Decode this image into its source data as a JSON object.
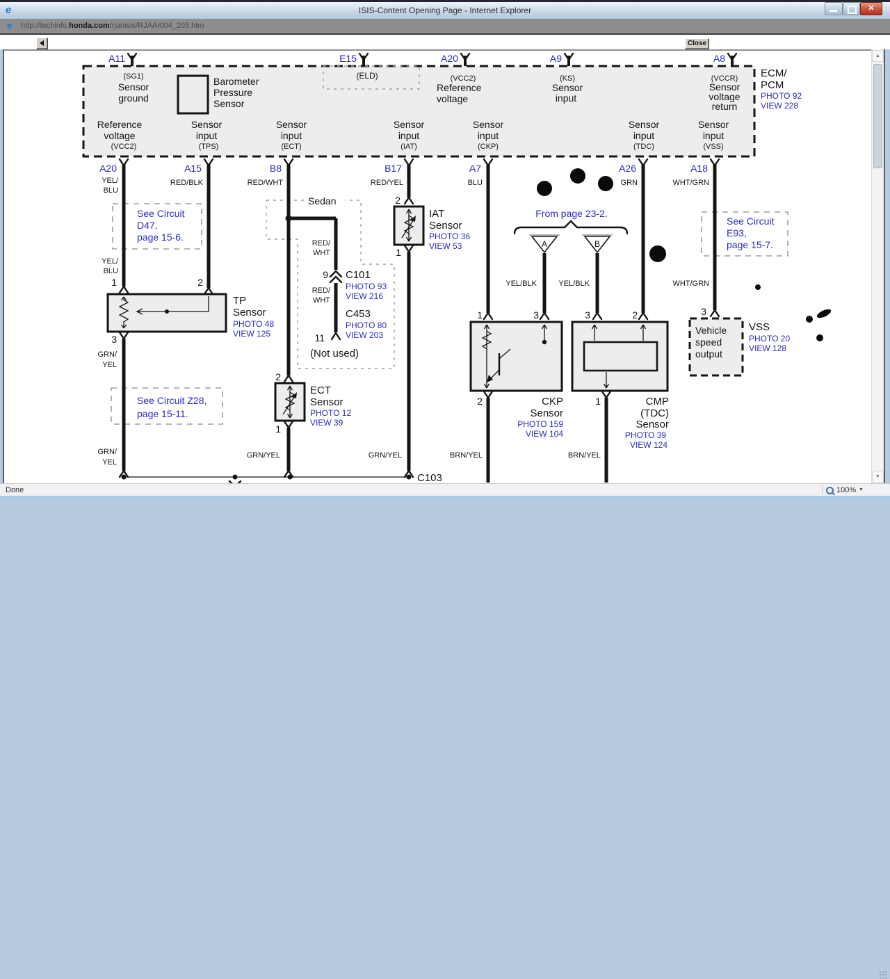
{
  "window": {
    "title": "ISIS-Content Opening Page - Internet Explorer",
    "url_prefix": "http://techinfo.",
    "url_domain": "honda.com",
    "url_path": "/rjanisis/RJAAI004_205.htm",
    "close_button": "Close",
    "status": "Done",
    "zoom": "100%"
  },
  "icons": {
    "ie": "e",
    "close": "✕",
    "scroll_up": "▲",
    "scroll_down": "▼",
    "caret": "▼"
  },
  "ecm": {
    "title1": "ECM/",
    "title2": "PCM",
    "photo": "PHOTO 92",
    "view": "VIEW 228",
    "pin_a11": "A11",
    "pin_e15": "E15",
    "pin_a20": "A20",
    "pin_a9": "A9",
    "pin_a8": "A8",
    "sg1_code": "(SG1)",
    "sg1_1": "Sensor",
    "sg1_2": "ground",
    "baro_1": "Barometer",
    "baro_2": "Pressure",
    "baro_3": "Sensor",
    "eld_code": "(ELD)",
    "vcc2t_code": "(VCC2)",
    "vcc2t_1": "Reference",
    "vcc2t_2": "voltage",
    "ks_code": "(KS)",
    "ks_1": "Sensor",
    "ks_2": "input",
    "vccr_code": "(VCCR)",
    "vccr_1": "Sensor",
    "vccr_2": "voltage",
    "vccr_3": "return",
    "b1_1": "Reference",
    "b1_2": "voltage",
    "b1_code": "(VCC2)",
    "b2_1": "Sensor",
    "b2_2": "input",
    "b2_code": "(TPS)",
    "b3_1": "Sensor",
    "b3_2": "input",
    "b3_code": "(ECT)",
    "b4_1": "Sensor",
    "b4_2": "input",
    "b4_code": "(IAT)",
    "b5_1": "Sensor",
    "b5_2": "input",
    "b5_code": "(CKP)",
    "b6_1": "Sensor",
    "b6_2": "input",
    "b6_code": "(TDC)",
    "b7_1": "Sensor",
    "b7_2": "input",
    "b7_code": "(VSS)"
  },
  "pins": {
    "a20": "A20",
    "a15": "A15",
    "b8": "B8",
    "b17": "B17",
    "a7": "A7",
    "a26": "A26",
    "a18": "A18"
  },
  "wires": {
    "yelblu1a": "YEL/",
    "yelblu1b": "BLU",
    "yelblu2a": "YEL/",
    "yelblu2b": "BLU",
    "redblk": "RED/BLK",
    "redwht": "RED/WHT",
    "redwht2a": "RED/",
    "redwht2b": "WHT",
    "redwht3a": "RED/",
    "redwht3b": "WHT",
    "redyel": "RED/YEL",
    "blu": "BLU",
    "grn": "GRN",
    "whtgrn1": "WHT/GRN",
    "whtgrn2": "WHT/GRN",
    "yelblk1": "YEL/BLK",
    "yelblk2": "YEL/BLK",
    "grnyel1a": "GRN/",
    "grnyel1b": "YEL",
    "grnyel2a": "GRN/",
    "grnyel2b": "YEL",
    "grnyel3": "GRN/YEL",
    "grnyel4": "GRN/YEL",
    "brnyel1": "BRN/YEL",
    "brnyel2": "BRN/YEL"
  },
  "sensors": {
    "tp": {
      "n1": "1",
      "n2": "2",
      "n3": "3",
      "name1": "TP",
      "name2": "Sensor",
      "photo": "PHOTO 48",
      "view": "VIEW 125"
    },
    "ect": {
      "n2": "2",
      "n1": "1",
      "name1": "ECT",
      "name2": "Sensor",
      "photo": "PHOTO 12",
      "view": "VIEW 39"
    },
    "iat": {
      "n2": "2",
      "n1": "1",
      "name1": "IAT",
      "name2": "Sensor",
      "photo": "PHOTO 36",
      "view": "VIEW 53"
    },
    "ckp": {
      "n1": "1",
      "n3": "3",
      "n2": "2",
      "name1": "CKP",
      "name2": "Sensor",
      "photo": "PHOTO 159",
      "view": "VIEW 104"
    },
    "cmp": {
      "n3": "3",
      "n2": "2",
      "n1": "1",
      "name1": "CMP",
      "name2": "(TDC)",
      "name3": "Sensor",
      "photo": "PHOTO 39",
      "view": "VIEW 124"
    },
    "vss": {
      "n3": "3",
      "box1": "Vehicle",
      "box2": "speed",
      "box3": "output",
      "name": "VSS",
      "photo": "PHOTO 20",
      "view": "VIEW 128"
    }
  },
  "connectors": {
    "c101_pin": "9",
    "c101": "C101",
    "c101_photo": "PHOTO 93",
    "c101_view": "VIEW 216",
    "c453": "C453",
    "c453_photo": "PHOTO 80",
    "c453_view": "VIEW 203",
    "c453_pin": "11",
    "c103": "C103"
  },
  "notes": {
    "d47_1": "See Circuit",
    "d47_2": "D47,",
    "d47_3": "page 15-6.",
    "z28_1": "See Circuit Z28,",
    "z28_2": "page 15-11.",
    "e93_1": "See Circuit",
    "e93_2": "E93,",
    "e93_3": "page 15-7.",
    "from_page": "From page 23-2.",
    "sedan": "Sedan",
    "not_used": "(Not used)",
    "tri_a": "A",
    "tri_b": "B"
  },
  "colors": {
    "link_blue": "#2a2ac0",
    "diagram_black": "#141414",
    "close_red": "#b03322"
  }
}
